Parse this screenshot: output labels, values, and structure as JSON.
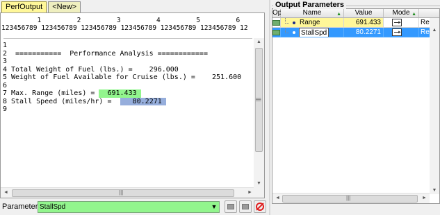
{
  "tabs": [
    {
      "label": "PerfOutput",
      "active": true
    },
    {
      "label": "<New>",
      "active": false
    }
  ],
  "ruler": {
    "tens": "         1         2         3         4         5         6",
    "units": "123456789 123456789 123456789 123456789 123456789 123456789 12"
  },
  "code_lines": [
    {
      "num": "1",
      "text": ""
    },
    {
      "num": "2",
      "text": " ===========  Performance Analysis ============"
    },
    {
      "num": "3",
      "text": ""
    },
    {
      "num": "4",
      "text": "Total Weight of Fuel (lbs.) =    296.000"
    },
    {
      "num": "5",
      "text": "Weight of Fuel Available for Cruise (lbs.) =    251.600"
    },
    {
      "num": "6",
      "text": ""
    },
    {
      "num": "7",
      "text": "Max. Range (miles) = ",
      "hl": "  691.433 ",
      "hl_color": "green"
    },
    {
      "num": "8",
      "text": "Stall Speed (miles/hr) =  ",
      "hl": "   80.2271 ",
      "hl_color": "blue"
    },
    {
      "num": "9",
      "text": ""
    }
  ],
  "parameter": {
    "label": "Parameter",
    "value": "StallSpd",
    "color": "#92f58d"
  },
  "output_parameters": {
    "title": "Output Parameters",
    "columns": [
      "Op",
      "Name",
      "Value",
      "Mode",
      ""
    ],
    "rows": [
      {
        "name": "Range",
        "value": "691.433",
        "mode_icon": "input-output-icon",
        "extra": "Rea",
        "highlight": "#fff799"
      },
      {
        "name": "StallSpd",
        "value": "80.2271",
        "mode_icon": "input-output-icon",
        "extra": "Rea",
        "selected": true
      }
    ]
  },
  "icons": {
    "scroll_left": "◄",
    "scroll_right": "►",
    "scroll_up": "▲",
    "scroll_down": "▼",
    "grip": "|||",
    "dropdown": "▼",
    "sort": "▲"
  }
}
